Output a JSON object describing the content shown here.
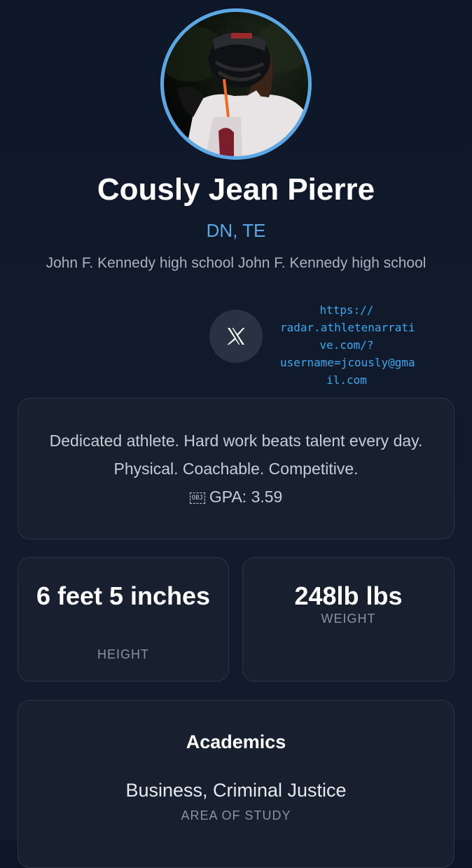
{
  "profile": {
    "name": "Cously Jean Pierre",
    "positions": "DN, TE",
    "school": "John F. Kennedy high school John F. Kennedy high school"
  },
  "social": {
    "x_icon": "x-logo-icon",
    "link": "https://\nradar.athletenarrati\nve.com/?\nusername=jcously@gma\nil.com"
  },
  "bio": {
    "text": "Dedicated athlete. Hard work beats talent every day. Physical. Coachable. Competitive.",
    "obj_glyph": "OBJ",
    "gpa": "GPA: 3.59"
  },
  "stats": {
    "height_value": "6 feet 5 inches",
    "height_label": "HEIGHT",
    "weight_value": "248lb lbs",
    "weight_label": "WEIGHT"
  },
  "academics": {
    "title": "Academics",
    "area_of_study": "Business, Criminal Justice",
    "area_label": "AREA OF STUDY"
  },
  "colors": {
    "accent": "#5aa9e6",
    "link": "#39a9f0",
    "background": "#111a2b",
    "card": "#18202f"
  }
}
